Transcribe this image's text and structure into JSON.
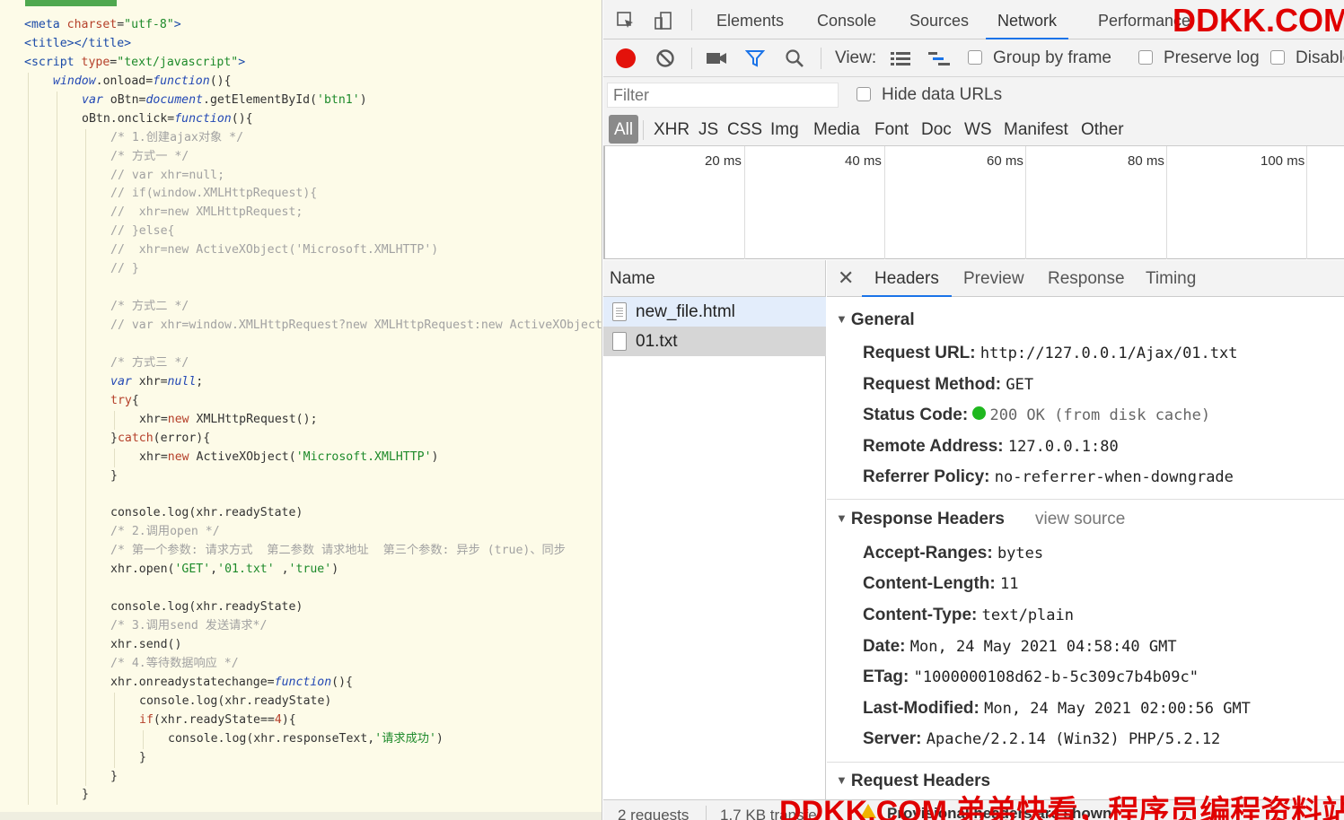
{
  "editor": {
    "lines": [
      {
        "indent": 0,
        "tokens": [
          [
            "t-tag",
            "<meta "
          ],
          [
            "t-attr",
            "charset"
          ],
          [
            "t-id",
            "="
          ],
          [
            "t-str",
            "\"utf-8\""
          ],
          [
            "t-tag",
            ">"
          ]
        ]
      },
      {
        "indent": 0,
        "tokens": [
          [
            "t-tag",
            "<title></title>"
          ]
        ]
      },
      {
        "indent": 0,
        "tokens": [
          [
            "t-tag",
            "<script "
          ],
          [
            "t-attr",
            "type"
          ],
          [
            "t-id",
            "="
          ],
          [
            "t-str",
            "\"text/javascript\""
          ],
          [
            "t-tag",
            ">"
          ]
        ]
      },
      {
        "indent": 1,
        "tokens": [
          [
            "t-kw",
            "window"
          ],
          [
            "t-id",
            ".onload="
          ],
          [
            "t-kw",
            "function"
          ],
          [
            "t-id",
            "(){"
          ]
        ]
      },
      {
        "indent": 2,
        "tokens": [
          [
            "t-kw",
            "var"
          ],
          [
            "t-id",
            " oBtn="
          ],
          [
            "t-kw",
            "document"
          ],
          [
            "t-id",
            ".getElementById("
          ],
          [
            "t-str",
            "'btn1'"
          ],
          [
            "t-id",
            ")"
          ]
        ]
      },
      {
        "indent": 2,
        "tokens": [
          [
            "t-id",
            "oBtn.onclick="
          ],
          [
            "t-kw",
            "function"
          ],
          [
            "t-id",
            "(){"
          ]
        ]
      },
      {
        "indent": 3,
        "tokens": [
          [
            "t-com",
            "/* 1.创建ajax对象 */"
          ]
        ]
      },
      {
        "indent": 3,
        "tokens": [
          [
            "t-com",
            "/* 方式一 */"
          ]
        ]
      },
      {
        "indent": 3,
        "tokens": [
          [
            "t-com",
            "// var xhr=null;"
          ]
        ]
      },
      {
        "indent": 3,
        "tokens": [
          [
            "t-com",
            "// if(window.XMLHttpRequest){"
          ]
        ]
      },
      {
        "indent": 3,
        "tokens": [
          [
            "t-com",
            "//  xhr=new XMLHttpRequest;"
          ]
        ]
      },
      {
        "indent": 3,
        "tokens": [
          [
            "t-com",
            "// }else{"
          ]
        ]
      },
      {
        "indent": 3,
        "tokens": [
          [
            "t-com",
            "//  xhr=new ActiveXObject('Microsoft.XMLHTTP')"
          ]
        ]
      },
      {
        "indent": 3,
        "tokens": [
          [
            "t-com",
            "// }"
          ]
        ]
      },
      {
        "indent": 3,
        "tokens": []
      },
      {
        "indent": 3,
        "tokens": [
          [
            "t-com",
            "/* 方式二 */"
          ]
        ]
      },
      {
        "indent": 3,
        "tokens": [
          [
            "t-com",
            "// var xhr=window.XMLHttpRequest?new XMLHttpRequest:new ActiveXObject"
          ]
        ]
      },
      {
        "indent": 3,
        "tokens": []
      },
      {
        "indent": 3,
        "tokens": [
          [
            "t-com",
            "/* 方式三 */"
          ]
        ]
      },
      {
        "indent": 3,
        "tokens": [
          [
            "t-kw",
            "var"
          ],
          [
            "t-id",
            " xhr="
          ],
          [
            "t-kw",
            "null"
          ],
          [
            "t-id",
            ";"
          ]
        ]
      },
      {
        "indent": 3,
        "tokens": [
          [
            "t-attr",
            "try"
          ],
          [
            "t-id",
            "{"
          ]
        ]
      },
      {
        "indent": 4,
        "tokens": [
          [
            "t-id",
            "xhr="
          ],
          [
            "t-attr",
            "new"
          ],
          [
            "t-id",
            " XMLHttpRequest();"
          ]
        ]
      },
      {
        "indent": 3,
        "tokens": [
          [
            "t-id",
            "}"
          ],
          [
            "t-attr",
            "catch"
          ],
          [
            "t-id",
            "(error){"
          ]
        ]
      },
      {
        "indent": 4,
        "tokens": [
          [
            "t-id",
            "xhr="
          ],
          [
            "t-attr",
            "new"
          ],
          [
            "t-id",
            " ActiveXObject("
          ],
          [
            "t-str",
            "'Microsoft.XMLHTTP'"
          ],
          [
            "t-id",
            ")"
          ]
        ]
      },
      {
        "indent": 3,
        "tokens": [
          [
            "t-id",
            "}"
          ]
        ]
      },
      {
        "indent": 3,
        "tokens": []
      },
      {
        "indent": 3,
        "tokens": [
          [
            "t-id",
            "console.log(xhr.readyState)"
          ]
        ]
      },
      {
        "indent": 3,
        "tokens": [
          [
            "t-com",
            "/* 2.调用open */"
          ]
        ]
      },
      {
        "indent": 3,
        "tokens": [
          [
            "t-com",
            "/* 第一个参数: 请求方式  第二参数 请求地址  第三个参数: 异步 (true)、同步"
          ]
        ]
      },
      {
        "indent": 3,
        "tokens": [
          [
            "t-id",
            "xhr.open("
          ],
          [
            "t-str",
            "'GET'"
          ],
          [
            "t-id",
            ","
          ],
          [
            "t-str",
            "'01.txt'"
          ],
          [
            "t-id",
            " ,"
          ],
          [
            "t-str",
            "'true'"
          ],
          [
            "t-id",
            ")"
          ]
        ]
      },
      {
        "indent": 3,
        "tokens": []
      },
      {
        "indent": 3,
        "tokens": [
          [
            "t-id",
            "console.log(xhr.readyState)"
          ]
        ]
      },
      {
        "indent": 3,
        "tokens": [
          [
            "t-com",
            "/* 3.调用send 发送请求*/"
          ]
        ]
      },
      {
        "indent": 3,
        "tokens": [
          [
            "t-id",
            "xhr.send()"
          ]
        ]
      },
      {
        "indent": 3,
        "tokens": [
          [
            "t-com",
            "/* 4.等待数据响应 */"
          ]
        ]
      },
      {
        "indent": 3,
        "tokens": [
          [
            "t-id",
            "xhr.onreadystatechange="
          ],
          [
            "t-kw",
            "function"
          ],
          [
            "t-id",
            "(){"
          ]
        ]
      },
      {
        "indent": 4,
        "tokens": [
          [
            "t-id",
            "console.log(xhr.readyState)"
          ]
        ]
      },
      {
        "indent": 4,
        "tokens": [
          [
            "t-attr",
            "if"
          ],
          [
            "t-id",
            "(xhr.readyState=="
          ],
          [
            "t-attr",
            "4"
          ],
          [
            "t-id",
            "){"
          ]
        ]
      },
      {
        "indent": 5,
        "tokens": [
          [
            "t-id",
            "console.log(xhr.responseText,"
          ],
          [
            "t-str",
            "'请求成功'"
          ],
          [
            "t-id",
            ")"
          ]
        ]
      },
      {
        "indent": 4,
        "tokens": [
          [
            "t-id",
            "}"
          ]
        ]
      },
      {
        "indent": 3,
        "tokens": [
          [
            "t-id",
            "}"
          ]
        ]
      },
      {
        "indent": 2,
        "tokens": [
          [
            "t-id",
            "}"
          ]
        ]
      }
    ]
  },
  "devtools": {
    "tabs": [
      "Elements",
      "Console",
      "Sources",
      "Network",
      "Performance"
    ],
    "active_tab": "Network",
    "toolbar": {
      "view_label": "View:",
      "group_by_frame": "Group by frame",
      "preserve_log": "Preserve log",
      "disable_cache": "Disable"
    },
    "filter": {
      "placeholder": "Filter",
      "hide_data_urls": "Hide data URLs"
    },
    "types": [
      "All",
      "XHR",
      "JS",
      "CSS",
      "Img",
      "Media",
      "Font",
      "Doc",
      "WS",
      "Manifest",
      "Other"
    ],
    "active_type": "All",
    "overview_ticks": [
      "20 ms",
      "40 ms",
      "60 ms",
      "80 ms",
      "100 ms"
    ],
    "name_header": "Name",
    "files": [
      {
        "name": "new_file.html",
        "state": "normal"
      },
      {
        "name": "01.txt",
        "state": "selected"
      }
    ],
    "detail_tabs": [
      "Headers",
      "Preview",
      "Response",
      "Timing"
    ],
    "active_detail_tab": "Headers",
    "general": {
      "title": "General",
      "items": [
        {
          "key": "Request URL:",
          "value": "http://127.0.0.1/Ajax/01.txt"
        },
        {
          "key": "Request Method:",
          "value": "GET"
        },
        {
          "key": "Status Code:",
          "value": "200 OK (from disk cache)"
        },
        {
          "key": "Remote Address:",
          "value": "127.0.0.1:80"
        },
        {
          "key": "Referrer Policy:",
          "value": "no-referrer-when-downgrade"
        }
      ]
    },
    "response_headers": {
      "title": "Response Headers",
      "view_source": "view source",
      "items": [
        {
          "key": "Accept-Ranges:",
          "value": "bytes"
        },
        {
          "key": "Content-Length:",
          "value": "11"
        },
        {
          "key": "Content-Type:",
          "value": "text/plain"
        },
        {
          "key": "Date:",
          "value": "Mon, 24 May 2021 04:58:40 GMT"
        },
        {
          "key": "ETag:",
          "value": "\"1000000108d62-b-5c309c7b4b09c\""
        },
        {
          "key": "Last-Modified:",
          "value": "Mon, 24 May 2021 02:00:56 GMT"
        },
        {
          "key": "Server:",
          "value": "Apache/2.2.14 (Win32) PHP/5.2.12"
        }
      ]
    },
    "request_headers": {
      "title": "Request Headers",
      "warning": "Provisional headers are shown"
    },
    "status_bar": {
      "requests": "2 requests",
      "transferred": "1.7 KB transfe"
    }
  },
  "watermark": {
    "top": "DDKK.COM",
    "bottom": "DDKK.COM 弟弟快看，程序员编程资料站"
  },
  "colors": {
    "record": "#e3120b",
    "accent": "#1a73e8",
    "status_ok": "#1fb81f",
    "watermark": "#e00000"
  }
}
